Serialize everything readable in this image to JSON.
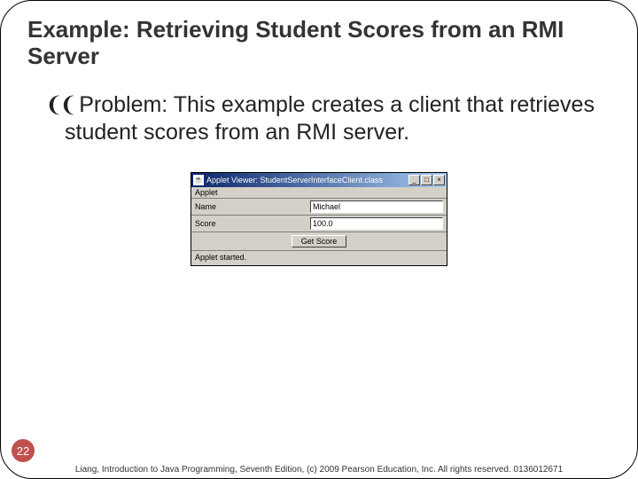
{
  "title": "Example: Retrieving Student Scores from an RMI Server",
  "bullet_glyph": "❨❨",
  "problem_text": "Problem: This example creates a client that retrieves student scores from an RMI server.",
  "applet": {
    "titlebar_icon": "☕",
    "titlebar_text": "Applet Viewer: StudentServerInterfaceClient.class",
    "min_label": "_",
    "max_label": "□",
    "close_label": "×",
    "menu_label": "Applet",
    "name_label": "Name",
    "name_value": "Michael",
    "score_label": "Score",
    "score_value": "100.0",
    "button_label": "Get Score",
    "status_text": "Applet started."
  },
  "page_number": "22",
  "footer": "Liang, Introduction to Java Programming, Seventh Edition, (c) 2009 Pearson Education, Inc. All rights reserved. 0136012671"
}
